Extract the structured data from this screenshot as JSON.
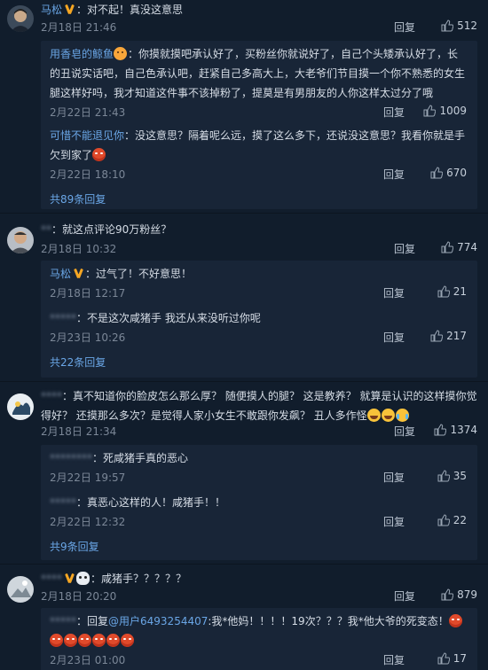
{
  "comments": [
    {
      "user": "马松",
      "verified": true,
      "text": "：对不起！真没这意思",
      "time": "2月18日 21:46",
      "reply": "回复",
      "likes": "512",
      "subs": [
        {
          "user": "用香皂的鲸鱼",
          "text": "：你摸就摸吧承认好了，买粉丝你就说好了，自己个头矮承认好了，长的丑说实话吧，自己色承认吧，赶紧自己多高大上，大老爷们节目摸一个你不熟悉的女生腿这样好吗，我才知道这件事不该掉粉了，提莫是有男朋友的人你这样太过分了哦",
          "time": "2月22日 21:43",
          "reply": "回复",
          "likes": "1009"
        },
        {
          "user": "可惜不能退见你",
          "text": "：没这意思？隔着呢么远，摸了这么多下，还说没这意思？我看你就是手欠到家了",
          "time": "2月22日 18:10",
          "reply": "回复",
          "likes": "670"
        }
      ],
      "more": "共89条回复"
    },
    {
      "user": "**",
      "verified": false,
      "text": "：就这点评论90万粉丝？",
      "time": "2月18日 10:32",
      "reply": "回复",
      "likes": "774",
      "subs": [
        {
          "user": "马松",
          "text": "：过气了！不好意思！",
          "time": "2月18日 12:17",
          "reply": "回复",
          "likes": "21"
        },
        {
          "user": "*****",
          "text": "：不是这次咸猪手 我还从来没听过你呢",
          "time": "2月23日 10:26",
          "reply": "回复",
          "likes": "217"
        }
      ],
      "more": "共22条回复"
    },
    {
      "user": "****",
      "verified": false,
      "text": "：真不知道你的脸皮怎么那么厚？ 随便摸人的腿？ 这是教养？ 就算是认识的这样摸你觉得好？ 还摸那么多次？是觉得人家小女生不敢跟你发飙？ 丑人多作怪",
      "time": "2月18日 21:34",
      "reply": "回复",
      "likes": "1374",
      "subs": [
        {
          "user": "********",
          "text": "：死咸猪手真的恶心",
          "time": "2月22日 19:57",
          "reply": "回复",
          "likes": "35"
        },
        {
          "user": "*****",
          "text": "：真恶心这样的人！咸猪手！！",
          "time": "2月22日 12:32",
          "reply": "回复",
          "likes": "22"
        }
      ],
      "more": "共9条回复"
    },
    {
      "user": "****",
      "verified": true,
      "text": "：咸猪手？？？？？",
      "time": "2月18日 20:20",
      "reply": "回复",
      "likes": "879",
      "subs": [
        {
          "user": "*****",
          "text_prefix": "：回复",
          "mention": "@用户6493254407",
          "text": ":我*他妈！！！！19次？？？我*他大爷的死变态！",
          "time": "2月23日 01:00",
          "reply": "回复",
          "likes": "17"
        }
      ]
    }
  ]
}
